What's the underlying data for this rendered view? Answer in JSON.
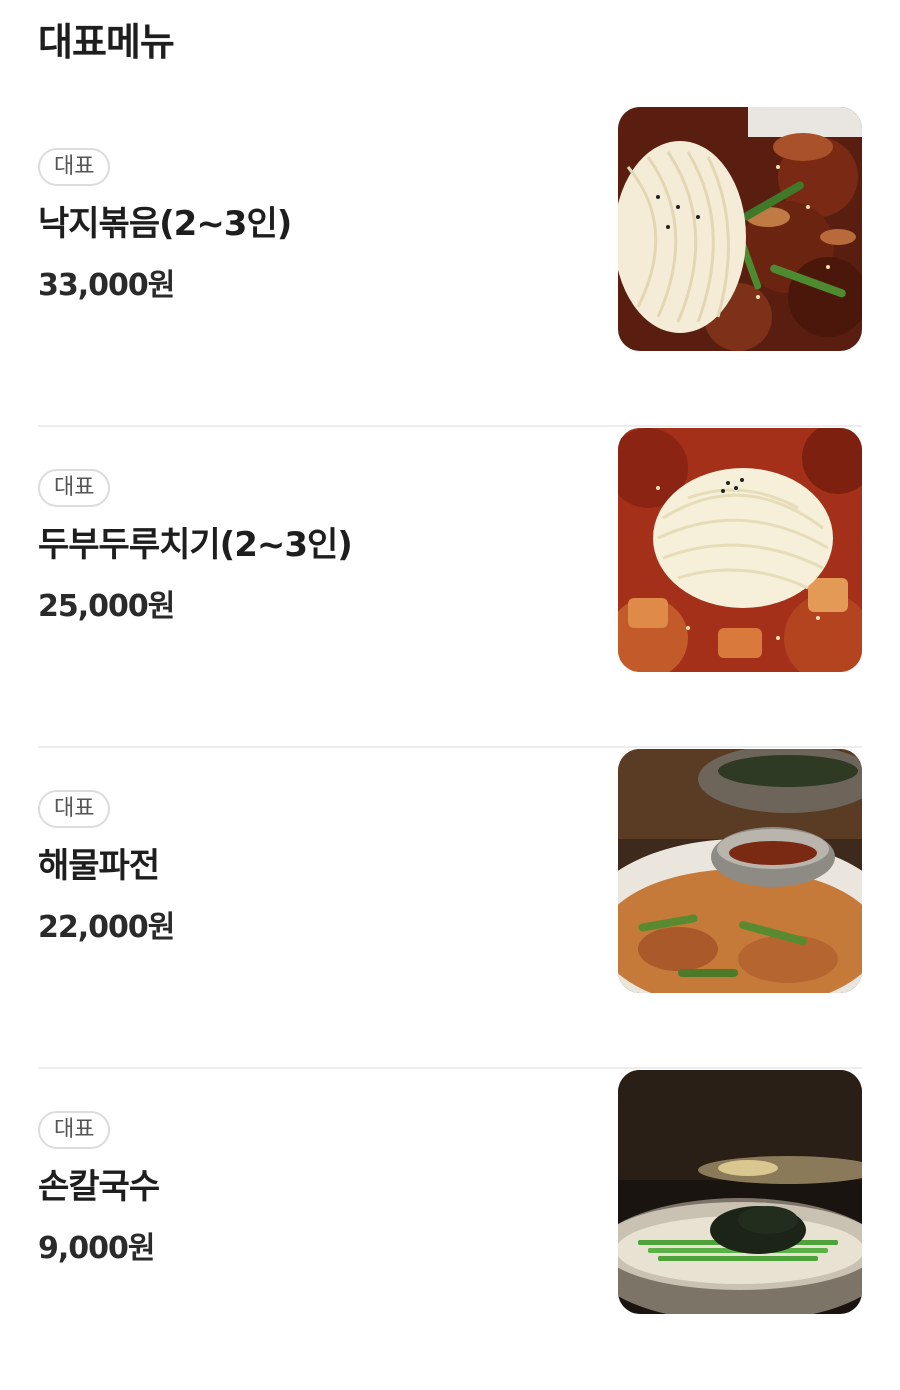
{
  "section": {
    "title": "대표메뉴"
  },
  "menu": {
    "items": [
      {
        "badge": "대표",
        "name": "낙지볶음(2~3인)",
        "price": "33,000원",
        "image": "spicy-stir-fried-octopus-with-noodles"
      },
      {
        "badge": "대표",
        "name": "두부두루치기(2~3인)",
        "price": "25,000원",
        "image": "spicy-braised-tofu-with-noodles"
      },
      {
        "badge": "대표",
        "name": "해물파전",
        "price": "22,000원",
        "image": "seafood-green-onion-pancake"
      },
      {
        "badge": "대표",
        "name": "손칼국수",
        "price": "9,000원",
        "image": "handmade-knife-cut-noodle-soup"
      }
    ]
  }
}
